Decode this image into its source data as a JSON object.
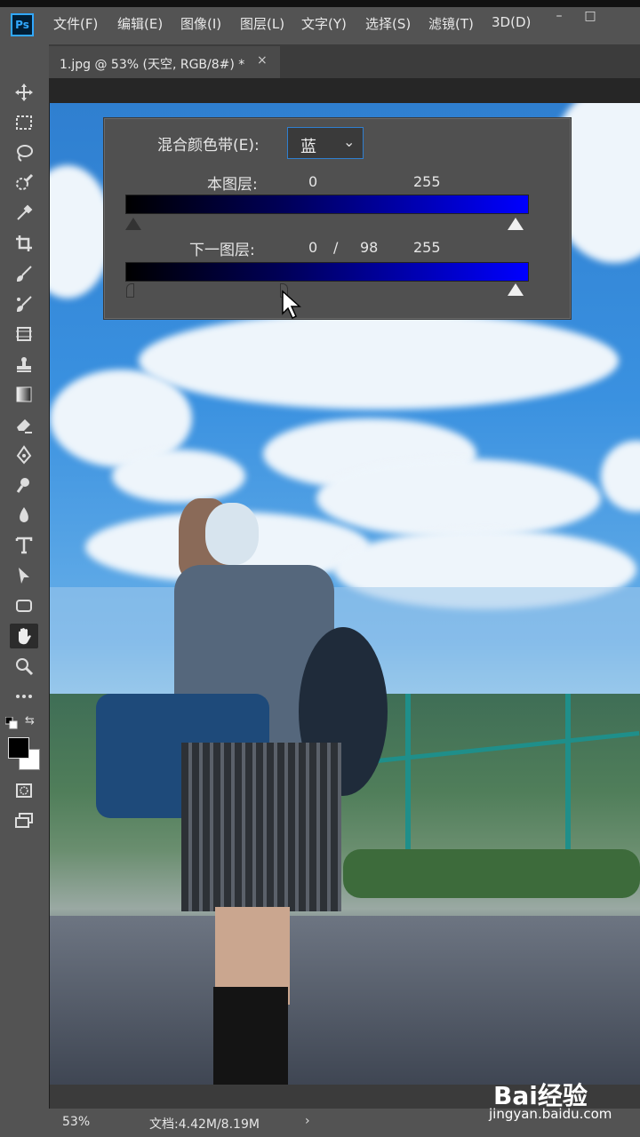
{
  "app": {
    "logo": "Ps"
  },
  "menu": [
    "文件(F)",
    "编辑(E)",
    "图像(I)",
    "图层(L)",
    "文字(Y)",
    "选择(S)",
    "滤镜(T)",
    "3D(D)"
  ],
  "window_controls": {
    "minimize": "–",
    "maximize": "□"
  },
  "tab": {
    "title": "1.jpg @ 53% (天空, RGB/8#) *",
    "close": "×"
  },
  "dialog": {
    "blend_label": "混合颜色带(E):",
    "blend_value": "蓝",
    "this_layer_label": "本图层:",
    "this_layer_min": "0",
    "this_layer_max": "255",
    "underlying_label": "下一图层:",
    "underlying_min": "0",
    "underlying_sep": "/",
    "underlying_split": "98",
    "underlying_max": "255"
  },
  "status": {
    "zoom": "53%",
    "doc": "文档:4.42M/8.19M",
    "arrow": "›"
  },
  "watermark": {
    "brand": "Bai经验",
    "url": "jingyan.baidu.com"
  },
  "colors": {
    "accent": "#31a8ff",
    "panel": "#535353",
    "dialog": "#505050",
    "blue_channel": "#0000ff"
  }
}
